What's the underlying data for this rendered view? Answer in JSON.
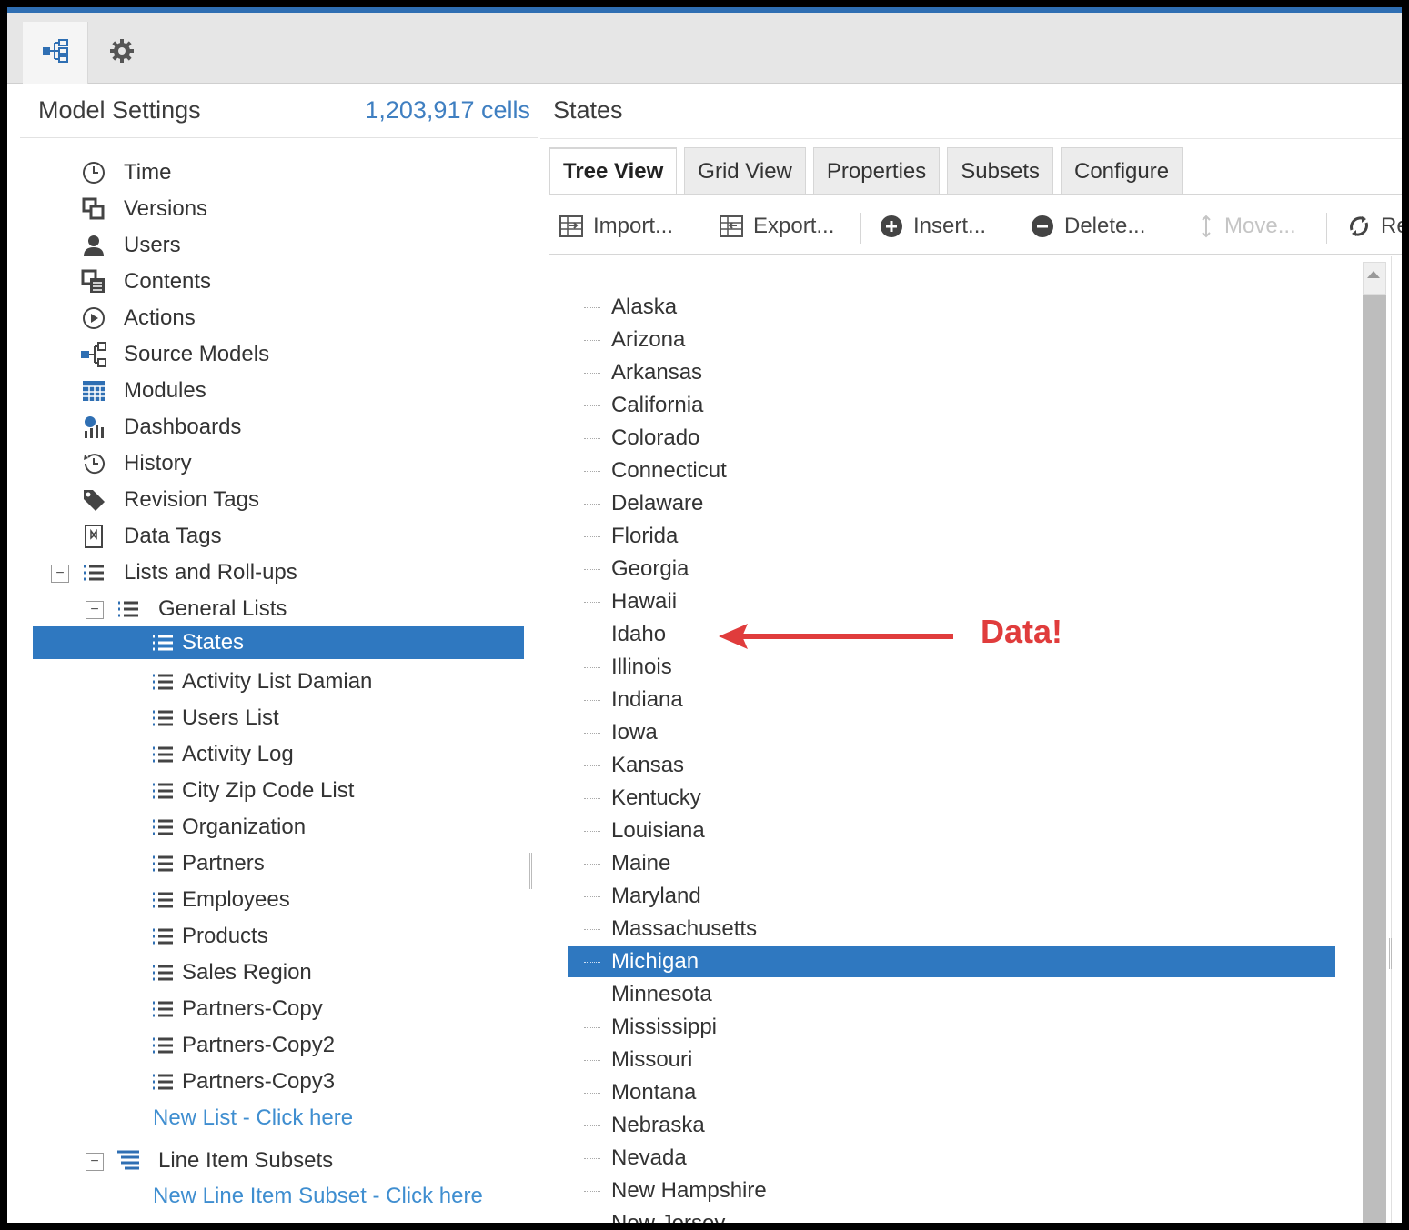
{
  "topbar": {
    "buttons": [
      {
        "icon": "hierarchy-icon",
        "active": true
      },
      {
        "icon": "gear-icon",
        "active": false
      }
    ]
  },
  "left": {
    "title": "Model Settings",
    "cell_count": "1,203,917 cells",
    "items": [
      {
        "label": "Time",
        "icon": "clock-icon"
      },
      {
        "label": "Versions",
        "icon": "versions-icon"
      },
      {
        "label": "Users",
        "icon": "user-icon"
      },
      {
        "label": "Contents",
        "icon": "contents-icon"
      },
      {
        "label": "Actions",
        "icon": "play-circle-icon"
      },
      {
        "label": "Source Models",
        "icon": "source-models-icon"
      },
      {
        "label": "Modules",
        "icon": "grid-icon"
      },
      {
        "label": "Dashboards",
        "icon": "dashboard-icon"
      },
      {
        "label": "History",
        "icon": "history-icon"
      },
      {
        "label": "Revision Tags",
        "icon": "tag-icon"
      },
      {
        "label": "Data Tags",
        "icon": "bookmark-icon"
      }
    ],
    "lists_group": {
      "label": "Lists and Roll-ups",
      "expander": "−"
    },
    "general_lists": {
      "label": "General Lists",
      "expander": "−"
    },
    "lists": [
      "States",
      "Activity List Damian",
      "Users List",
      "Activity Log",
      "City Zip Code List",
      "Organization",
      "Partners",
      "Employees",
      "Products",
      "Sales Region",
      "Partners-Copy",
      "Partners-Copy2",
      "Partners-Copy3"
    ],
    "selected_list": "States",
    "new_list_link": "New List - Click here",
    "line_item_subsets": {
      "label": "Line Item Subsets",
      "expander": "−"
    },
    "new_subset_link": "New Line Item Subset - Click here"
  },
  "right": {
    "title": "States",
    "tabs": [
      "Tree View",
      "Grid View",
      "Properties",
      "Subsets",
      "Configure"
    ],
    "active_tab": "Tree View",
    "toolbar": {
      "import": "Import...",
      "export": "Export...",
      "insert": "Insert...",
      "delete": "Delete...",
      "move": "Move...",
      "refresh": "Re"
    },
    "states": [
      "Alaska",
      "Arizona",
      "Arkansas",
      "California",
      "Colorado",
      "Connecticut",
      "Delaware",
      "Florida",
      "Georgia",
      "Hawaii",
      "Idaho",
      "Illinois",
      "Indiana",
      "Iowa",
      "Kansas",
      "Kentucky",
      "Louisiana",
      "Maine",
      "Maryland",
      "Massachusetts",
      "Michigan",
      "Minnesota",
      "Mississippi",
      "Missouri",
      "Montana",
      "Nebraska",
      "Nevada",
      "New Hampshire",
      "New Jersey"
    ],
    "selected_state": "Michigan"
  },
  "annotation": {
    "label": "Data!",
    "color": "#e03c3c"
  },
  "colors": {
    "accent": "#2f78c0",
    "link": "#3f8ed0",
    "topstrip": "#2f6fb3"
  }
}
